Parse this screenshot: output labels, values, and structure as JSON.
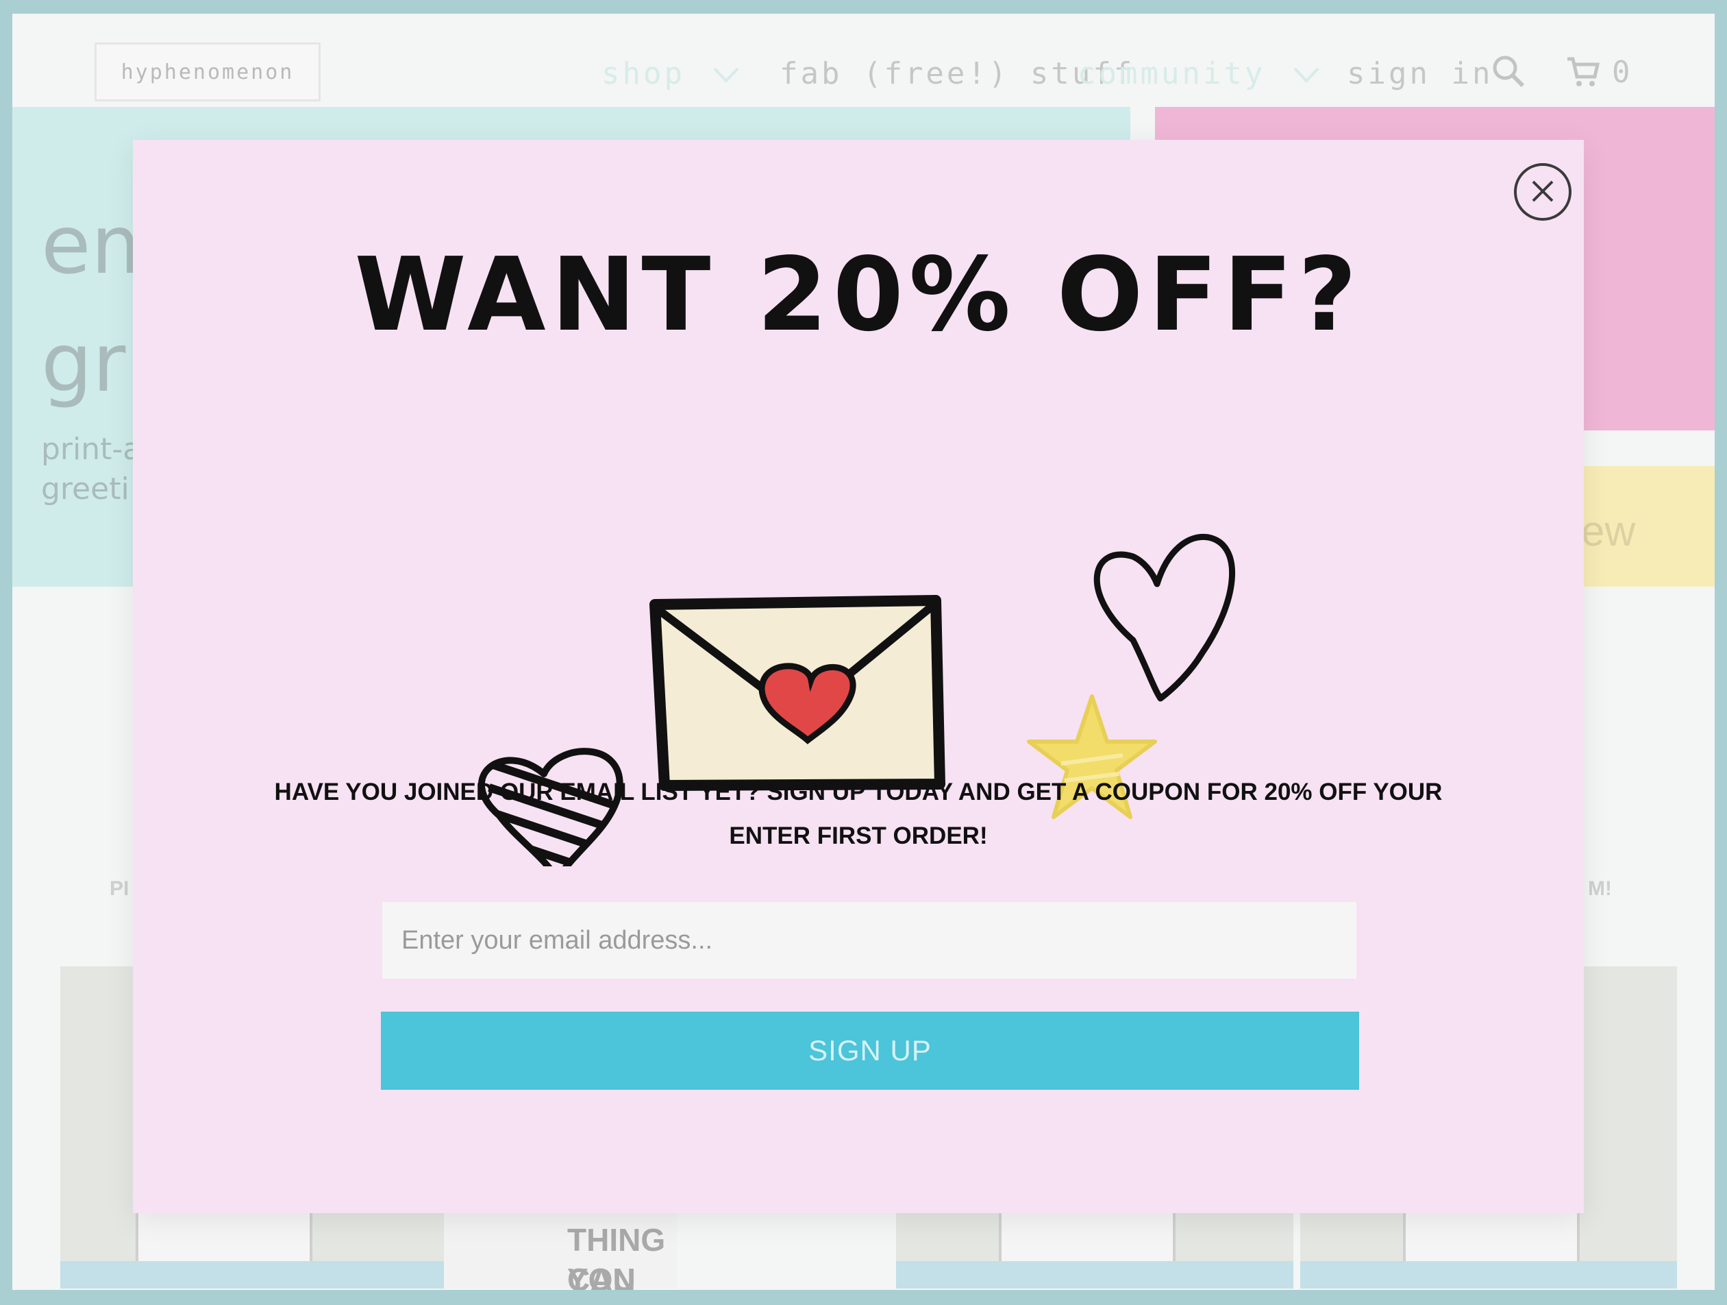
{
  "site": {
    "logo": "hyphenomenon",
    "nav": {
      "shop": "shop",
      "fab_stuff": "fab (free!) stuff",
      "community": "community",
      "sign_in": "sign in",
      "cart_count": "0"
    },
    "hero": {
      "line1": "em",
      "line2": "gr",
      "line3": "print-a",
      "line4": "greeti"
    },
    "side_right_button": "ew",
    "left_edge_text": "PI",
    "right_edge_text": "M!",
    "product_texts": [
      "CAN WEAR",
      "THING YOU",
      "CAN WEAR"
    ]
  },
  "modal": {
    "headline": "WANT 20% OFF?",
    "message_line1": "HAVE YOU JOINED OUR EMAIL LIST YET? SIGN UP TODAY AND GET A COUPON FOR 20% OFF YOUR",
    "message_line2": "ENTER FIRST ORDER!",
    "email_placeholder": "Enter your email address...",
    "signup_label": "SIGN UP"
  },
  "icons": {
    "close": "close-icon",
    "search": "search-icon",
    "cart": "cart-icon",
    "envelope": "envelope-icon",
    "hearts": [
      "striped-heart-icon",
      "outline-heart-icon"
    ],
    "star": "star-icon"
  },
  "colors": {
    "modal_bg": "#f6e2f3",
    "button_bg": "#4cc4d9",
    "frame_border": "#a9cfd3"
  }
}
